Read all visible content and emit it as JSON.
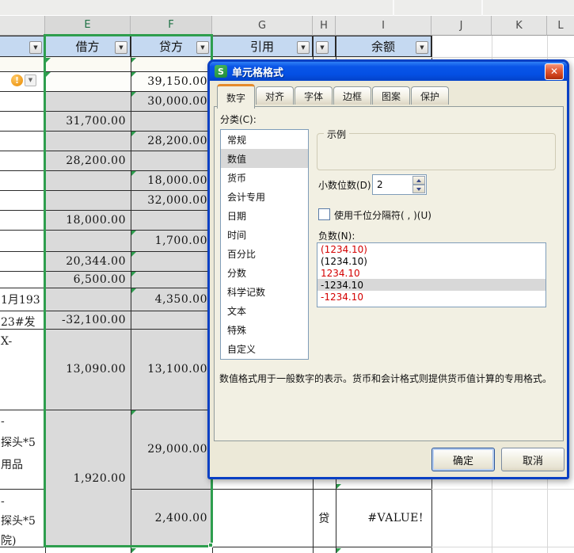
{
  "sheet": {
    "column_letters": [
      "E",
      "F",
      "G",
      "H",
      "I",
      "J",
      "K",
      "L"
    ],
    "filter_headers": {
      "debit": "借方",
      "credit": "贷方",
      "reference": "引用",
      "balance": "余额"
    },
    "warning_icon": "!",
    "rows": [
      {
        "credit": "39,150.00"
      },
      {
        "credit": "30,000.00"
      },
      {
        "debit": "31,700.00"
      },
      {
        "credit": "28,200.00"
      },
      {
        "debit": "28,200.00"
      },
      {
        "credit": "18,000.00"
      },
      {
        "credit": "32,000.00"
      },
      {
        "debit": "18,000.00"
      },
      {
        "credit": "1,700.00"
      },
      {
        "debit": "20,344.00"
      },
      {
        "debit": "6,500.00"
      },
      {
        "d": "1月193",
        "credit": "4,350.00"
      },
      {
        "d": "23#发",
        "debit": "-32,100.00"
      },
      {
        "d": "X-",
        "debit": "13,090.00",
        "credit": "13,100.00"
      },
      {
        "d1": "-",
        "d2": "探头*5",
        "d3": "用品",
        "credit": "29,000.00"
      },
      {
        "d1": "-",
        "d2": "探头*5",
        "d3": "院)",
        "credit": "2,400.00",
        "h": "贷",
        "i": "#VALUE!"
      }
    ],
    "merged_debit": "1,920.00"
  },
  "dialog": {
    "title": "单元格格式",
    "app_icon": "S",
    "close_icon": "✕",
    "tabs": [
      "数字",
      "对齐",
      "字体",
      "边框",
      "图案",
      "保护"
    ],
    "active_tab": "数字",
    "category_label": "分类(C):",
    "categories": [
      "常规",
      "数值",
      "货币",
      "会计专用",
      "日期",
      "时间",
      "百分比",
      "分数",
      "科学记数",
      "文本",
      "特殊",
      "自定义"
    ],
    "selected_category": "数值",
    "sample_label": "示例",
    "decimal_label": "小数位数(D):",
    "decimal_value": "2",
    "thousands_label": "使用千位分隔符( , )(U)",
    "negative_label": "负数(N):",
    "negative_options": [
      {
        "text": "(1234.10)",
        "color": "#d40000"
      },
      {
        "text": "(1234.10)",
        "color": "#000000"
      },
      {
        "text": "1234.10",
        "color": "#d40000"
      },
      {
        "text": "-1234.10",
        "color": "#000000",
        "selected": true
      },
      {
        "text": "-1234.10",
        "color": "#d40000"
      }
    ],
    "description": "数值格式用于一般数字的表示。货币和会计格式则提供货币值计算的专用格式。",
    "ok_label": "确定",
    "cancel_label": "取消",
    "colors": {
      "title_bar": "#0a55e8",
      "active_tab_accent": "#e68b2c",
      "selection_green": "#2e9e4e",
      "header_blue": "#c5d9f1",
      "negative_red": "#d40000"
    }
  }
}
